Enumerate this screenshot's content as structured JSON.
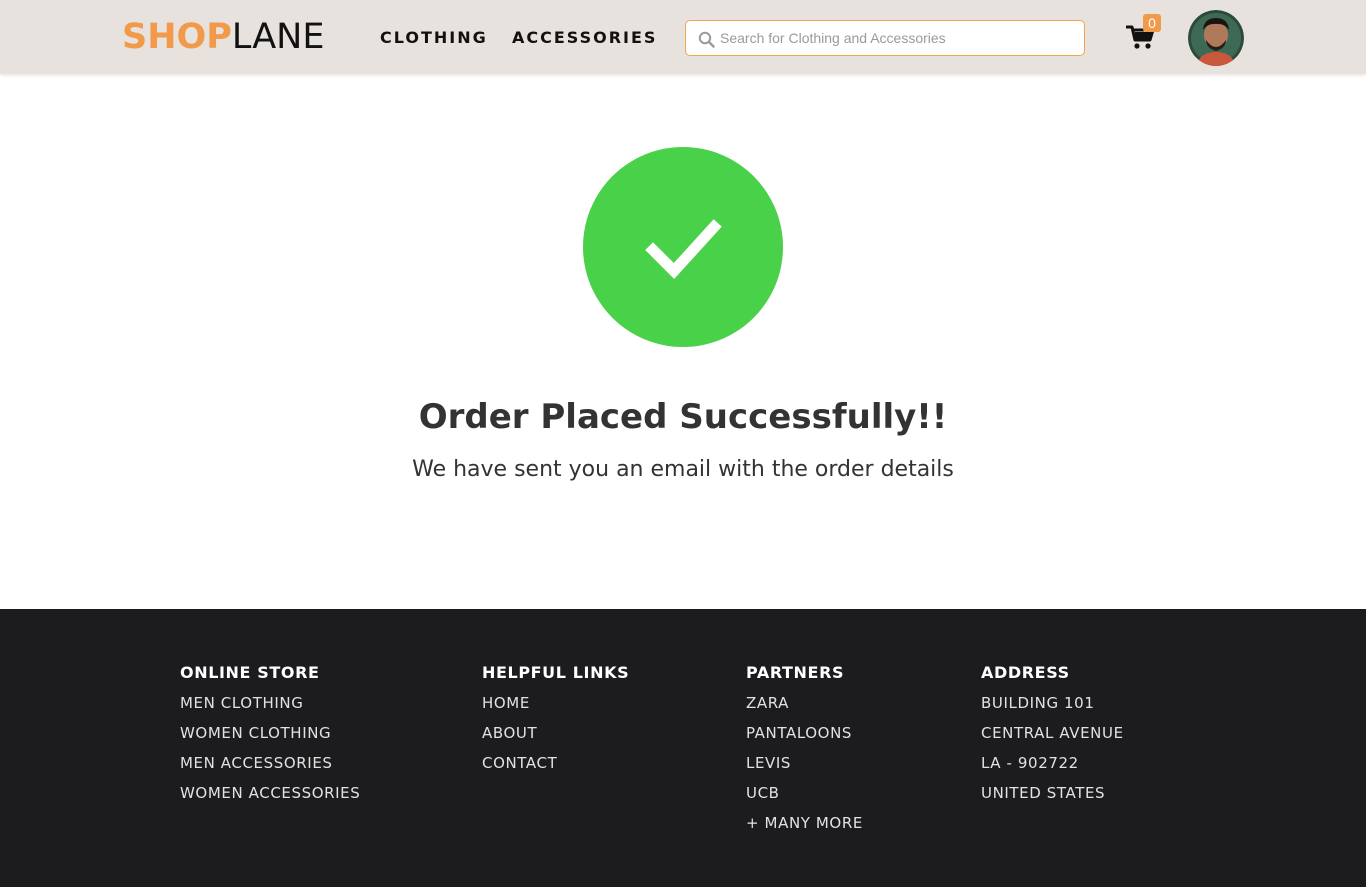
{
  "header": {
    "logo_primary": "SHOP",
    "logo_secondary": "LANE",
    "nav": [
      "CLOTHING",
      "ACCESSORIES"
    ],
    "search_placeholder": "Search for Clothing and Accessories",
    "cart_count": "0",
    "cart_icon": "cart-icon",
    "search_icon": "search-icon",
    "avatar_icon": "avatar"
  },
  "main": {
    "status_icon": "check-icon",
    "title": "Order Placed Successfully!!",
    "subtitle": "We have sent you an email with the order details"
  },
  "footer": {
    "columns": [
      {
        "heading": "ONLINE STORE",
        "items": [
          "MEN CLOTHING",
          "WOMEN CLOTHING",
          "MEN ACCESSORIES",
          "WOMEN ACCESSORIES"
        ]
      },
      {
        "heading": "HELPFUL LINKS",
        "items": [
          "HOME",
          "ABOUT",
          "CONTACT"
        ]
      },
      {
        "heading": "PARTNERS",
        "items": [
          "ZARA",
          "PANTALOONS",
          "LEVIS",
          "UCB",
          "+ MANY MORE"
        ]
      },
      {
        "heading": "ADDRESS",
        "items": [
          "BUILDING 101",
          "CENTRAL AVENUE",
          "LA - 902722",
          "UNITED STATES"
        ]
      }
    ]
  },
  "colors": {
    "accent": "#f09a4a",
    "header_bg": "#e8e2df",
    "success": "#4ad14a",
    "footer_bg": "#1c1c1e"
  }
}
